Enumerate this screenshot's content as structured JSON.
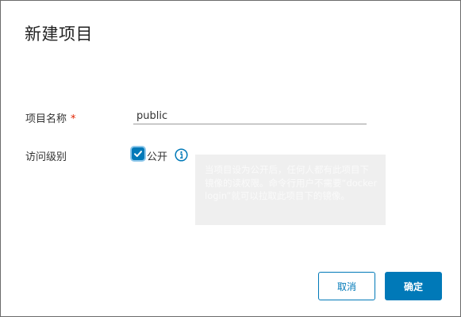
{
  "dialog": {
    "title": "新建项目"
  },
  "form": {
    "project_name": {
      "label": "项目名称",
      "required_mark": "*",
      "value": "public"
    },
    "access_level": {
      "label": "访问级别",
      "checkbox_checked": true,
      "checkbox_label": "公开",
      "info_icon": "info-icon"
    }
  },
  "tooltip": {
    "text": "当项目设为公开后，任何人都有此项目下镜像的读权限。命令行用户不需要“docker login”就可以拉取此项目下的镜像。"
  },
  "buttons": {
    "cancel_label": "取消",
    "ok_label": "确定"
  },
  "colors": {
    "accent": "#0079b8",
    "required": "#e12200",
    "tooltip_bg": "#efefef"
  }
}
